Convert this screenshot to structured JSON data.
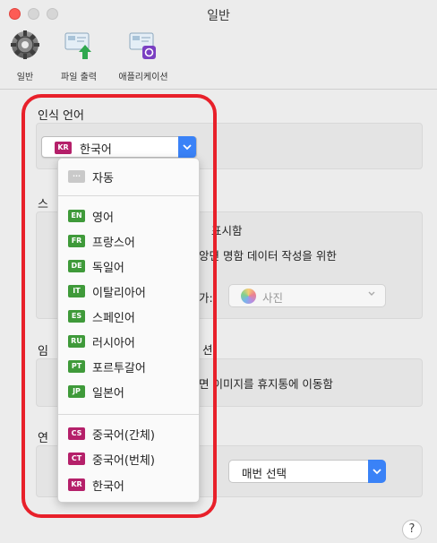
{
  "window": {
    "title": "일반"
  },
  "toolbar": {
    "general_label": "일반",
    "file_output_label": "파일 출력",
    "application_label": "애플리케이션"
  },
  "recognition": {
    "section_title": "인식 언어",
    "selected_flag": "KR",
    "selected_label": "한국어"
  },
  "background_text": {
    "sec2_initial": "스",
    "row1": "표시함",
    "row2": "앙면 명함 데이터 작성을 위한",
    "row3": "가:",
    "sec3_initial": "임",
    "sec3_suffix": "션",
    "row4": "면 이미지를 휴지통에 이동함",
    "sec4_initial": "연"
  },
  "photos_select": {
    "label": "사진"
  },
  "every_select": {
    "label": "매번 선택"
  },
  "dropdown": {
    "auto": {
      "flag": "···",
      "label": "자동"
    },
    "group1": [
      {
        "flag": "EN",
        "label": "영어"
      },
      {
        "flag": "FR",
        "label": "프랑스어"
      },
      {
        "flag": "DE",
        "label": "독일어"
      },
      {
        "flag": "IT",
        "label": "이탈리아어"
      },
      {
        "flag": "ES",
        "label": "스페인어"
      },
      {
        "flag": "RU",
        "label": "러시아어"
      },
      {
        "flag": "PT",
        "label": "포르투갈어"
      },
      {
        "flag": "JP",
        "label": "일본어"
      }
    ],
    "group2": [
      {
        "flag": "CS",
        "label": "중국어(간체)"
      },
      {
        "flag": "CT",
        "label": "중국어(번체)"
      },
      {
        "flag": "KR",
        "label": "한국어"
      }
    ]
  },
  "help": {
    "label": "?"
  },
  "colors": {
    "accent": "#3a82f7",
    "highlight": "#e8202a",
    "flag_green": "#3f9a3a",
    "flag_magenta": "#b5206a"
  }
}
